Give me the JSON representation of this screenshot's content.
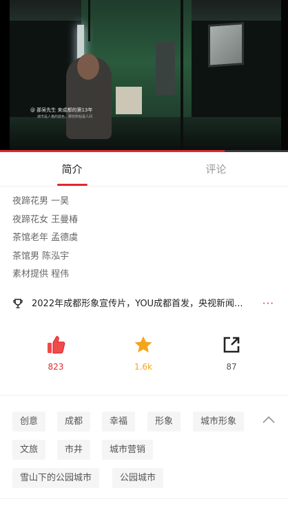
{
  "video": {
    "caption_line1": "@ 那吴先生  来成都的第13年",
    "caption_line2": "城市是人格的底色，那份熨帖是人间",
    "progress_fraction": 0.78
  },
  "tabs": [
    {
      "label": "简介",
      "active": true
    },
    {
      "label": "评论",
      "active": false
    }
  ],
  "credits": [
    "夜蹄花男 一昊",
    "夜蹄花女 王曼椿",
    "茶馆老年 孟德虞",
    "茶馆男 陈泓宇",
    "素材提供 程伟"
  ],
  "title": {
    "icon": "trophy-icon",
    "text": "2022年成都形象宣传片，YOU成都首发，央视新闻...",
    "more": "···"
  },
  "actions": {
    "like": {
      "icon": "thumbs-up-icon",
      "count": "823",
      "color": "#e0282e"
    },
    "favorite": {
      "icon": "star-icon",
      "count": "1.6k",
      "color": "#f4a51c"
    },
    "share": {
      "icon": "share-icon",
      "count": "87",
      "color": "#333333"
    }
  },
  "tags": [
    "创意",
    "成都",
    "幸福",
    "形象",
    "城市形象",
    "文旅",
    "市井",
    "城市营销",
    "雪山下的公园城市",
    "公园城市"
  ],
  "collapse_icon": "chevron-up-icon",
  "accent_color": "#e0282e"
}
